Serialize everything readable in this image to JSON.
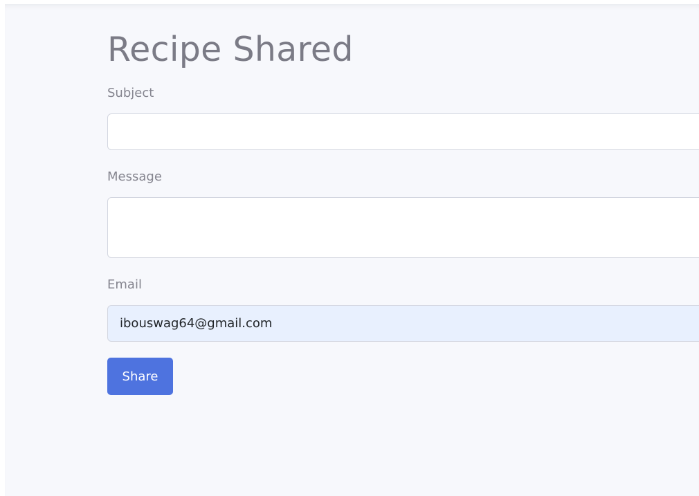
{
  "page": {
    "title": "Recipe Shared"
  },
  "form": {
    "subject": {
      "label": "Subject",
      "value": "",
      "placeholder": ""
    },
    "message": {
      "label": "Message",
      "value": "",
      "placeholder": ""
    },
    "email": {
      "label": "Email",
      "value": "ibouswag64@gmail.com",
      "placeholder": ""
    },
    "share_label": "Share"
  },
  "colors": {
    "background": "#f7f8fc",
    "primary_button": "#4e73df",
    "autofill_field": "#e8f0fe",
    "title_text": "#7b7b86"
  }
}
